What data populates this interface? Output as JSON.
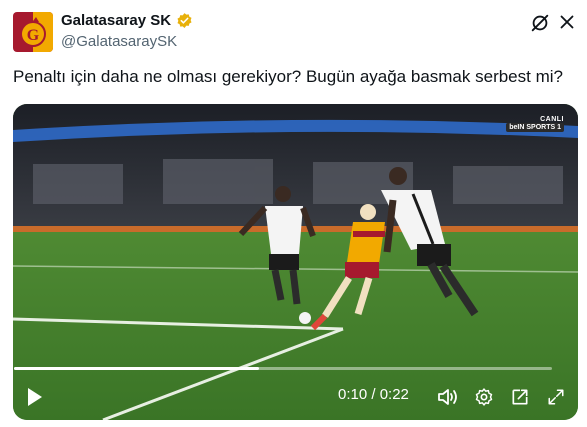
{
  "tweet": {
    "display_name": "Galatasaray SK",
    "handle": "@GalatasaraySK",
    "text": "Penaltı için daha ne olması gerekiyor? Bugün ayağa basmak serbest mi?"
  },
  "video": {
    "live_label": "CANLI",
    "channel_label": "beIN SPORTS 1",
    "current_time": "0:10",
    "duration": "0:22",
    "time_display": "0:10 / 0:22",
    "progress": 0.455
  },
  "colors": {
    "verified_badge": "#e8b10b",
    "text_primary": "#0f1419",
    "text_secondary": "#536471",
    "pitch": "#3f7a2a"
  },
  "icons": [
    "verified-badge-icon",
    "grok-icon",
    "close-icon",
    "play-icon",
    "volume-icon",
    "settings-icon",
    "pip-icon",
    "fullscreen-icon"
  ]
}
